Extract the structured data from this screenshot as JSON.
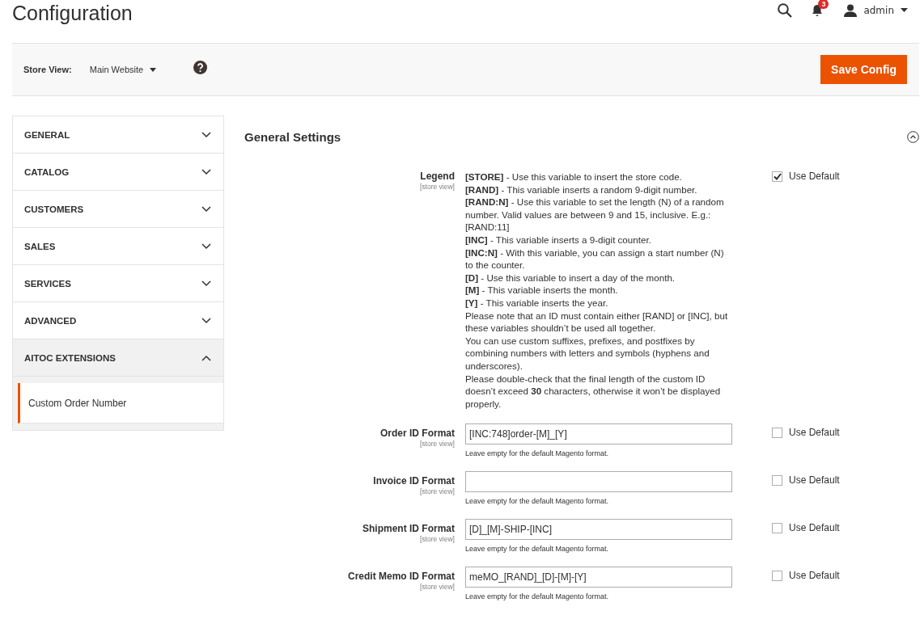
{
  "header": {
    "title": "Configuration",
    "notifications": "3",
    "user": "admin"
  },
  "store_bar": {
    "label": "Store View:",
    "scope": "Main Website",
    "save_button": "Save Config"
  },
  "sidebar": {
    "items": [
      {
        "label": "GENERAL",
        "expanded": false
      },
      {
        "label": "CATALOG",
        "expanded": false
      },
      {
        "label": "CUSTOMERS",
        "expanded": false
      },
      {
        "label": "SALES",
        "expanded": false
      },
      {
        "label": "SERVICES",
        "expanded": false
      },
      {
        "label": "ADVANCED",
        "expanded": false
      },
      {
        "label": "AITOC EXTENSIONS",
        "expanded": true,
        "children": [
          {
            "label": "Custom Order Number",
            "selected": true
          }
        ]
      }
    ]
  },
  "section": {
    "title": "General Settings",
    "expanded": true,
    "legend": {
      "label": "Legend",
      "scope": "[store view]",
      "use_default": {
        "label": "Use Default",
        "checked": true
      },
      "lines": [
        "**[STORE]** - Use this variable to insert the store code.",
        "**[RAND]** - This variable inserts a random 9-digit number.",
        "**[RAND:N]** - Use this variable to set the length (N) of a random number. Valid values are between 9 and 15, inclusive. E.g.: [RAND:11]",
        "**[INC]** - This variable inserts a 9-digit counter.",
        "**[INC:N]** - With this variable, you can assign a start number (N) to the counter.",
        "**[D]** - Use this variable to insert a day of the month.",
        "**[M]** - This variable inserts the month.",
        "**[Y]** - This variable inserts the year.",
        "Please note that an ID must contain either [RAND] or [INC], but these variables shouldn’t be used all together.",
        "You can use custom suffixes, prefixes, and postfixes by combining numbers with letters and symbols (hyphens and underscores).",
        "Please double-check that the final length of the custom ID doesn’t exceed **30** characters, otherwise it won’t be displayed properly."
      ]
    },
    "fields": [
      {
        "label": "Order ID Format",
        "scope": "[store view]",
        "value": "[INC:748]order-[M]_[Y]",
        "note": "Leave empty for the default Magento format.",
        "use_default": {
          "label": "Use Default",
          "checked": false
        }
      },
      {
        "label": "Invoice ID Format",
        "scope": "[store view]",
        "note": "Leave empty for the default Magento format.",
        "use_default": {
          "label": "Use Default",
          "checked": false
        }
      },
      {
        "label": "Shipment ID Format",
        "scope": "[store view]",
        "value": "[D]_[M]-SHIP-[INC]",
        "note": "Leave empty for the default Magento format.",
        "use_default": {
          "label": "Use Default",
          "checked": false
        }
      },
      {
        "label": "Credit Memo ID Format",
        "scope": "[store view]",
        "value": "meMO_[RAND]_[D]-[M]-[Y]",
        "note": "Leave empty for the default Magento format.",
        "use_default": {
          "label": "Use Default",
          "checked": false
        }
      }
    ]
  }
}
